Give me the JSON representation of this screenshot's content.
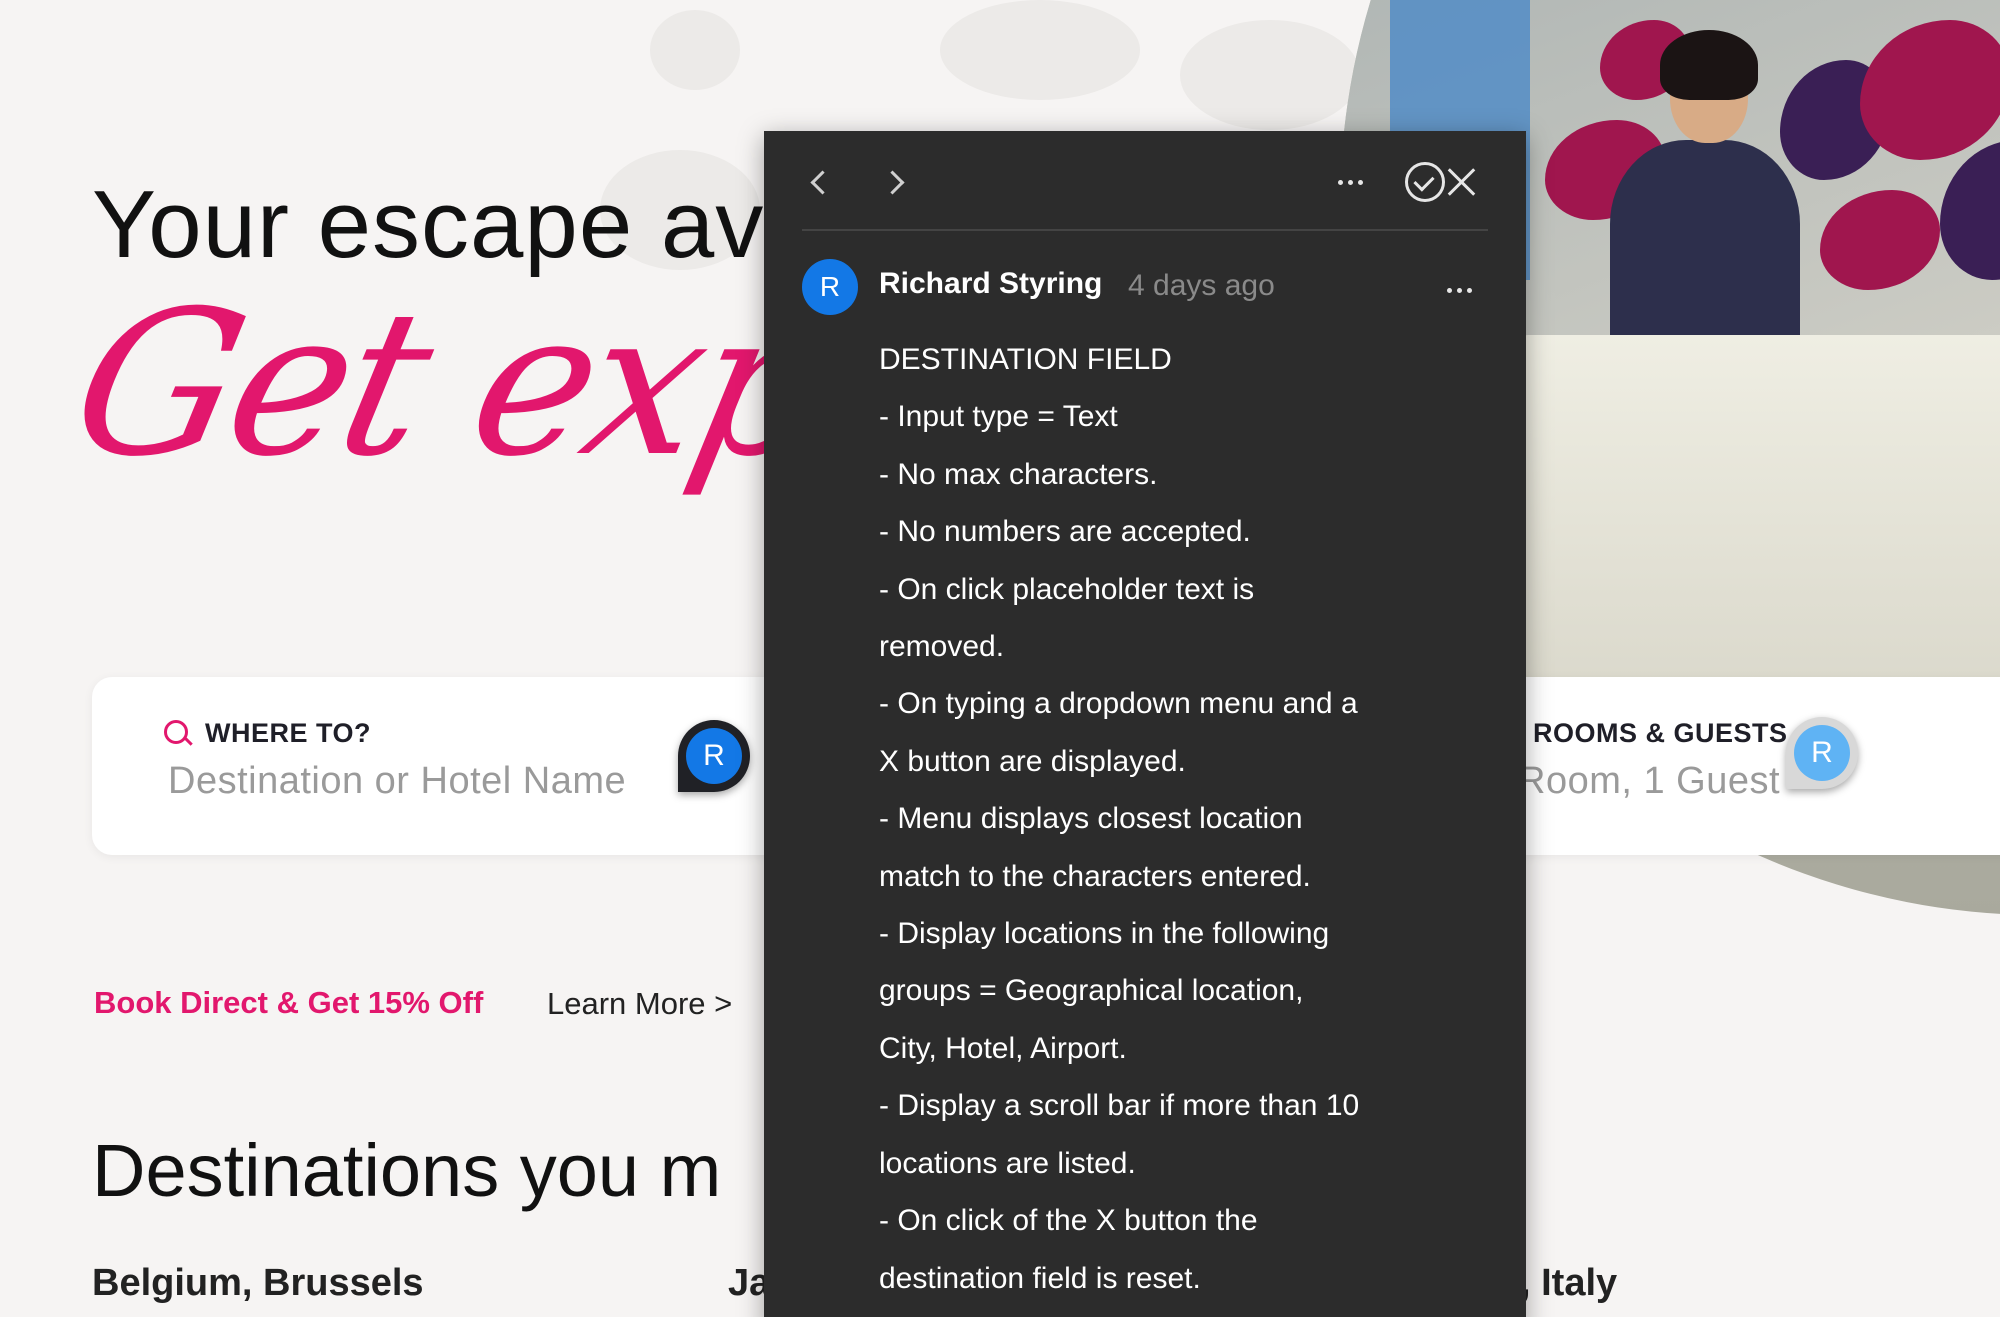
{
  "hero": {
    "title": "Your escape av",
    "script_title": "Get exploring"
  },
  "search": {
    "destination_label": "WHERE TO?",
    "destination_placeholder": "Destination or Hotel Name",
    "rooms_label": "ROOMS & GUESTS",
    "rooms_value": "Room, 1 Guest",
    "pin_letter": "R"
  },
  "promo": {
    "text": "Book Direct & Get 15% Off",
    "learn_more": "Learn More >"
  },
  "destinations": {
    "heading": "Destinations you m",
    "cities": [
      "Belgium, Brussels",
      "Ja",
      ", Italy"
    ]
  },
  "comment_panel": {
    "author_initial": "R",
    "author_name": "Richard Styring",
    "timestamp": "4 days ago",
    "lines": [
      "DESTINATION FIELD",
      "- Input type = Text",
      "- No max characters.",
      "- No numbers are accepted.",
      "- On click placeholder text is",
      "removed.",
      "- On typing a dropdown menu and a",
      "X button are displayed.",
      "- Menu displays closest location",
      "match to the characters entered.",
      "- Display locations in the following",
      "groups = Geographical location,",
      "City, Hotel, Airport.",
      "- Display a scroll bar if more than 10",
      "locations are listed.",
      "- On click of the X button the",
      "destination field is reset."
    ],
    "icons": {
      "prev": "chevron-left-icon",
      "next": "chevron-right-icon",
      "more": "more-dots-icon",
      "resolve": "check-circle-icon",
      "close": "close-icon"
    }
  },
  "colors": {
    "accent": "#e2176d",
    "panel_bg": "#2c2c2c",
    "avatar_blue": "#1378e6"
  }
}
